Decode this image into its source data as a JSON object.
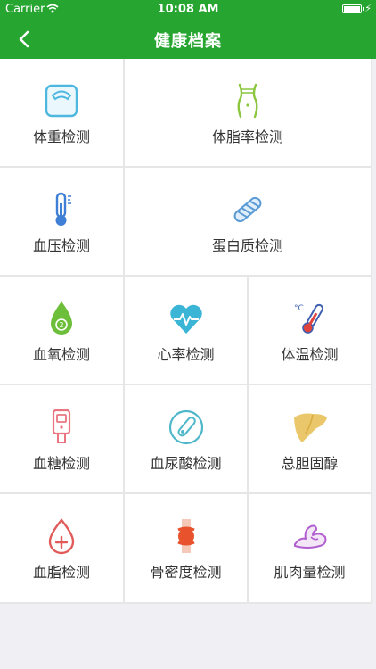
{
  "status_bar": {
    "carrier": "Carrier",
    "time": "10:08 AM"
  },
  "nav": {
    "title": "健康档案"
  },
  "items": [
    {
      "label": "体重检测",
      "icon": "scale-icon"
    },
    {
      "label": "体脂率检测",
      "icon": "body-fat-waist-icon"
    },
    {
      "label": "血压检测",
      "icon": "thermometer-gauge-icon"
    },
    {
      "label": "蛋白质检测",
      "icon": "protein-strand-icon"
    },
    {
      "label": "血氧检测",
      "icon": "oxygen-drop-icon"
    },
    {
      "label": "心率检测",
      "icon": "heart-rate-icon"
    },
    {
      "label": "体温检测",
      "icon": "temperature-thermometer-icon"
    },
    {
      "label": "血糖检测",
      "icon": "glucose-meter-icon"
    },
    {
      "label": "血尿酸检测",
      "icon": "uric-acid-icon"
    },
    {
      "label": "总胆固醇",
      "icon": "liver-icon"
    },
    {
      "label": "血脂检测",
      "icon": "blood-lipid-drop-icon"
    },
    {
      "label": "骨密度检测",
      "icon": "bone-joint-icon"
    },
    {
      "label": "肌肉量检测",
      "icon": "muscle-arm-icon"
    }
  ]
}
